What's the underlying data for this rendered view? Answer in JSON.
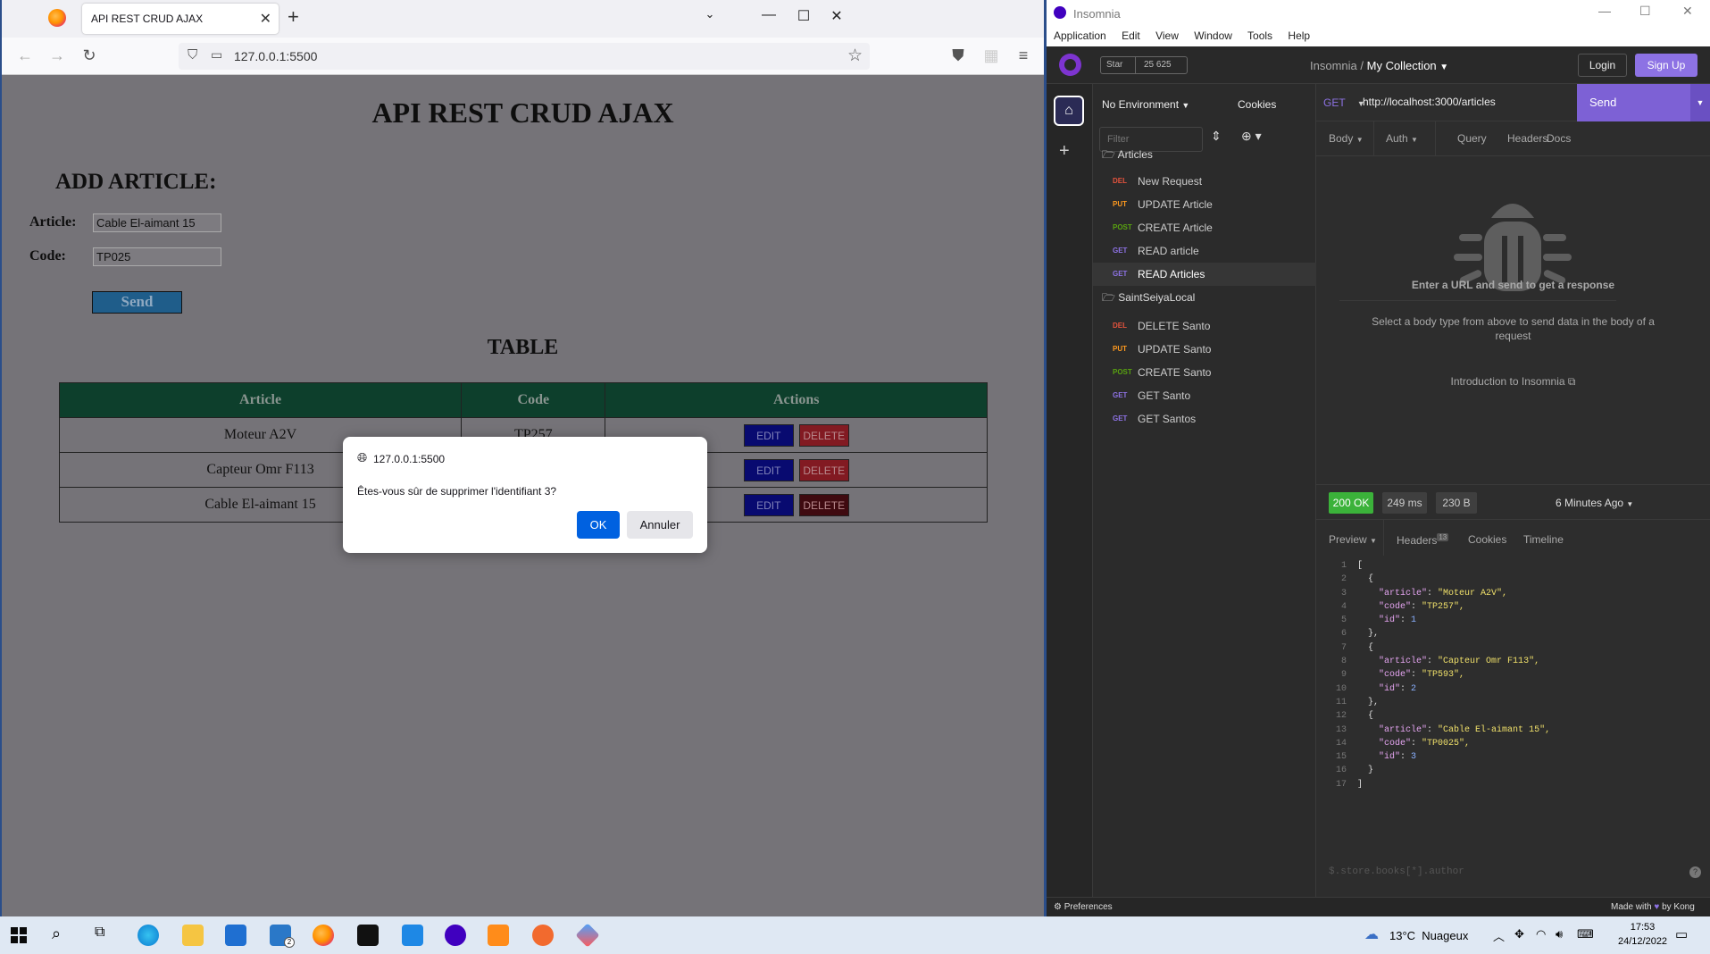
{
  "firefox": {
    "tab_title": "API REST CRUD AJAX",
    "url": "127.0.0.1:5500",
    "page": {
      "title": "API REST CRUD AJAX",
      "add_heading": "ADD ARTICLE:",
      "article_label": "Article:",
      "article_value": "Cable El-aimant 15",
      "code_label": "Code:",
      "code_value": "TP025",
      "send_label": "Send",
      "table_title": "TABLE",
      "columns": [
        "Article",
        "Code",
        "Actions"
      ],
      "rows": [
        {
          "article": "Moteur A2V",
          "code": "TP257"
        },
        {
          "article": "Capteur Omr F113",
          "code": ""
        },
        {
          "article": "Cable El-aimant 15",
          "code": ""
        }
      ],
      "edit_label": "EDIT",
      "delete_label": "DELETE"
    },
    "dialog": {
      "host": "127.0.0.1:5500",
      "message": "Êtes-vous sûr de supprimer l'identifiant 3?",
      "ok_label": "OK",
      "cancel_label": "Annuler"
    }
  },
  "insomnia": {
    "window_title": "Insomnia",
    "menu": [
      "Application",
      "Edit",
      "View",
      "Window",
      "Tools",
      "Help"
    ],
    "github_star": "Star",
    "github_count": "25 625",
    "breadcrumb_root": "Insomnia",
    "breadcrumb_sep": "/",
    "breadcrumb_current": "My Collection",
    "login_label": "Login",
    "signup_label": "Sign Up",
    "environment": "No Environment",
    "cookies_label": "Cookies",
    "filter_placeholder": "Filter",
    "folders": [
      {
        "name": "Articles",
        "requests": [
          {
            "method": "DEL",
            "name": "New Request",
            "color": "#e5533d"
          },
          {
            "method": "PUT",
            "name": "UPDATE Article",
            "color": "#ff9a1f"
          },
          {
            "method": "POST",
            "name": "CREATE Article",
            "color": "#59a210"
          },
          {
            "method": "GET",
            "name": "READ article",
            "color": "#8d72e4"
          },
          {
            "method": "GET",
            "name": "READ Articles",
            "color": "#8d72e4"
          }
        ]
      },
      {
        "name": "SaintSeiyaLocal",
        "requests": [
          {
            "method": "DEL",
            "name": "DELETE Santo",
            "color": "#e5533d"
          },
          {
            "method": "PUT",
            "name": "UPDATE Santo",
            "color": "#ff9a1f"
          },
          {
            "method": "POST",
            "name": "CREATE Santo",
            "color": "#59a210"
          },
          {
            "method": "GET",
            "name": "GET Santo",
            "color": "#8d72e4"
          },
          {
            "method": "GET",
            "name": "GET Santos",
            "color": "#8d72e4"
          }
        ]
      }
    ],
    "request": {
      "method": "GET",
      "url": "http://localhost:3000/articles",
      "send_label": "Send",
      "tabs": [
        "Body",
        "Auth",
        "Query",
        "Headers",
        "Docs"
      ],
      "empty_title": "Enter a URL and send to get a response",
      "empty_sub": "Select a body type from above to send data in the body of a request",
      "intro_link": "Introduction to Insomnia"
    },
    "response": {
      "status": "200 OK",
      "time": "249 ms",
      "size": "230 B",
      "ago": "6 Minutes Ago",
      "tabs": [
        "Preview",
        "Headers",
        "Cookies",
        "Timeline"
      ],
      "headers_count": "13",
      "filter_placeholder": "$.store.books[*].author",
      "json_lines": [
        "[",
        "  {",
        "    \"article\": \"Moteur A2V\",",
        "    \"code\": \"TP257\",",
        "    \"id\": 1",
        "  },",
        "  {",
        "    \"article\": \"Capteur Omr F113\",",
        "    \"code\": \"TP593\",",
        "    \"id\": 2",
        "  },",
        "  {",
        "    \"article\": \"Cable El-aimant 15\",",
        "    \"code\": \"TP0025\",",
        "    \"id\": 3",
        "  }",
        "]"
      ],
      "line_numbers": [
        "1",
        "2",
        "3",
        "4",
        "5",
        "6",
        "7",
        "8",
        "9",
        "10",
        "11",
        "12",
        "13",
        "14",
        "15",
        "16",
        "17"
      ]
    },
    "preferences_label": "Preferences",
    "made_with": "Made with",
    "by_kong": "by Kong"
  },
  "taskbar": {
    "weather_temp": "13°C",
    "weather_text": "Nuageux",
    "time": "17:53",
    "date": "24/12/2022",
    "mail_badge": "2"
  }
}
